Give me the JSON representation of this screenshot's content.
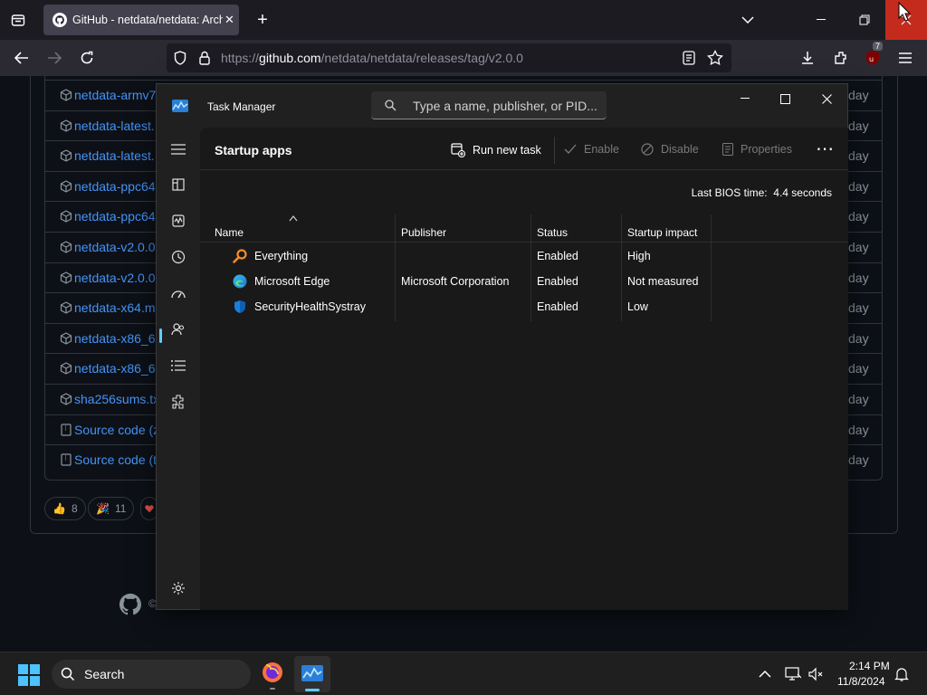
{
  "browser": {
    "tab_title": "GitHub - netdata/netdata: Arch",
    "url_prefix": "https://",
    "url_host": "github.com",
    "url_path": "/netdata/netdata/releases/tag/v2.0.0",
    "extension_badge": "7"
  },
  "github": {
    "assets": [
      {
        "name": "netdata-armv7",
        "date": "day"
      },
      {
        "name": "netdata-latest.",
        "date": "day"
      },
      {
        "name": "netdata-latest.",
        "date": "day"
      },
      {
        "name": "netdata-ppc64",
        "date": "day"
      },
      {
        "name": "netdata-ppc64",
        "date": "day"
      },
      {
        "name": "netdata-v2.0.0",
        "date": "day"
      },
      {
        "name": "netdata-v2.0.0",
        "date": "day"
      },
      {
        "name": "netdata-x64.m",
        "date": "day"
      },
      {
        "name": "netdata-x86_6",
        "date": "day"
      },
      {
        "name": "netdata-x86_6",
        "date": "day"
      },
      {
        "name": "sha256sums.tx",
        "date": "day"
      },
      {
        "name": "Source code (z",
        "date": "day"
      },
      {
        "name": "Source code (t",
        "date": "day"
      }
    ],
    "reactions": [
      {
        "emoji": "👍",
        "count": "8"
      },
      {
        "emoji": "🎉",
        "count": "11"
      }
    ],
    "footer_copyright": "©"
  },
  "task_manager": {
    "title": "Task Manager",
    "search_placeholder": "Type a name, publisher, or PID...",
    "page_title": "Startup apps",
    "commands": {
      "run_new_task": "Run new task",
      "enable": "Enable",
      "disable": "Disable",
      "properties": "Properties",
      "more": "⋯"
    },
    "bios_label": "Last BIOS time:",
    "bios_value": "4.4 seconds",
    "columns": [
      "Name",
      "Publisher",
      "Status",
      "Startup impact"
    ],
    "rows": [
      {
        "name": "Everything",
        "publisher": "",
        "status": "Enabled",
        "impact": "High",
        "icon": "everything-icon"
      },
      {
        "name": "Microsoft Edge",
        "publisher": "Microsoft Corporation",
        "status": "Enabled",
        "impact": "Not measured",
        "icon": "edge-icon"
      },
      {
        "name": "SecurityHealthSystray",
        "publisher": "",
        "status": "Enabled",
        "impact": "Low",
        "icon": "shield-icon"
      }
    ]
  },
  "taskbar": {
    "search_label": "Search",
    "time": "2:14 PM",
    "date": "11/8/2024"
  },
  "colors": {
    "accent": "#60cdff",
    "link": "#4493f8",
    "close_red": "#c42b1c"
  }
}
